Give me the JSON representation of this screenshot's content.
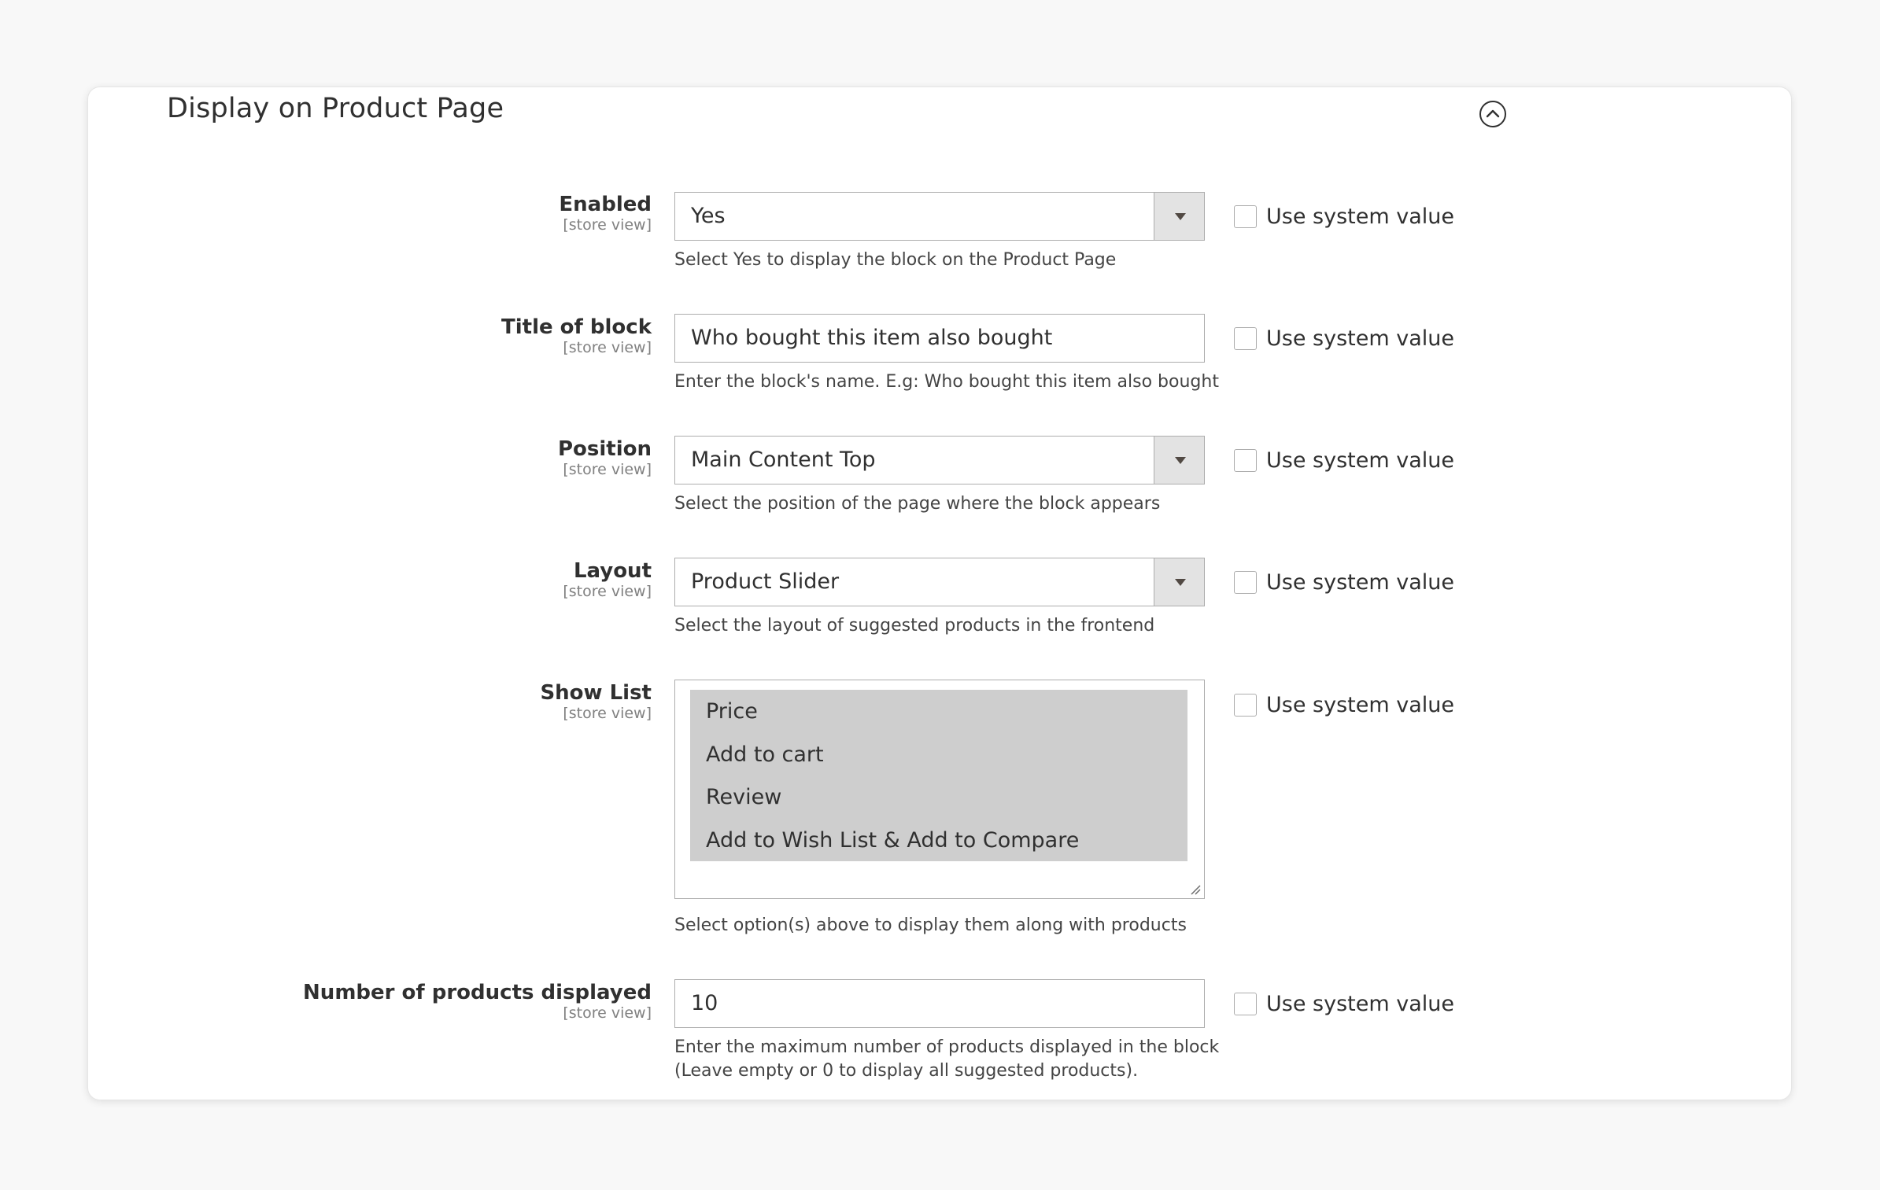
{
  "section": {
    "title": "Display on Product Page",
    "collapse_icon": "chevron-up-circle-icon"
  },
  "scope_label": "[store view]",
  "use_system_value_label": "Use system value",
  "fields": {
    "enabled": {
      "label": "Enabled",
      "value": "Yes",
      "note": "Select Yes to display the block on the Product Page",
      "use_system_value": false
    },
    "title_of_block": {
      "label": "Title of block",
      "value": "Who bought this item also bought",
      "note": "Enter the block's name. E.g: Who bought this item also bought",
      "use_system_value": false
    },
    "position": {
      "label": "Position",
      "value": "Main Content Top",
      "note": "Select the position of the page where the block appears",
      "use_system_value": false
    },
    "layout": {
      "label": "Layout",
      "value": "Product Slider",
      "note": "Select the layout of suggested products in the frontend",
      "use_system_value": false
    },
    "show_list": {
      "label": "Show List",
      "options": [
        "Price",
        "Add to cart",
        "Review",
        "Add to Wish List & Add to Compare"
      ],
      "note": "Select option(s) above to display them along with products",
      "use_system_value": false
    },
    "number_of_products": {
      "label": "Number of products displayed",
      "value": "10",
      "note_line1": "Enter the maximum number of products displayed in the block",
      "note_line2": "(Leave empty or 0 to display all suggested products).",
      "use_system_value": false
    }
  },
  "colors": {
    "background": "#f8f8f8",
    "card": "#ffffff",
    "border": "#adadad",
    "selected_options": "#cecece",
    "text": "#303030"
  }
}
